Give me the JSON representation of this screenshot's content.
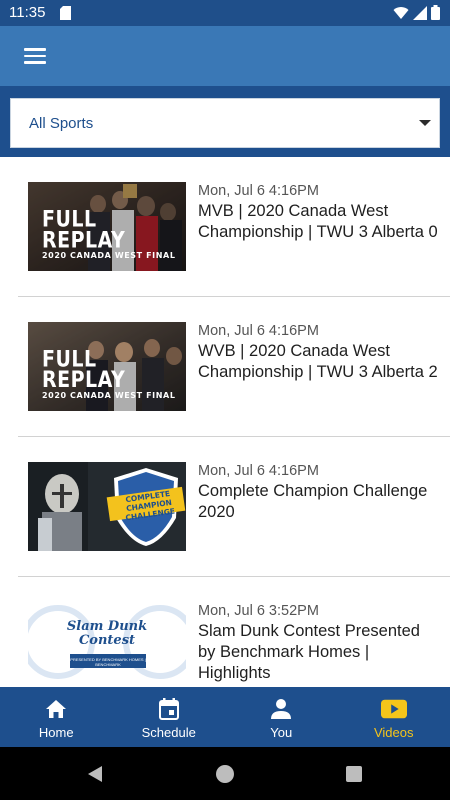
{
  "status_bar": {
    "time": "11:35"
  },
  "filter": {
    "selected": "All Sports"
  },
  "videos": [
    {
      "date": "Mon, Jul 6 4:16PM",
      "title": "MVB | 2020 Canada West Championship | TWU 3 Alberta 0",
      "thumb_line1": "FULL",
      "thumb_line2": "REPLAY",
      "thumb_sub": "2020 CANADA WEST FINAL"
    },
    {
      "date": "Mon, Jul 6 4:16PM",
      "title": "WVB | 2020 Canada West Championship | TWU 3 Alberta 2",
      "thumb_line1": "FULL",
      "thumb_line2": "REPLAY",
      "thumb_sub": "2020 CANADA WEST FINAL"
    },
    {
      "date": "Mon, Jul 6 4:16PM",
      "title": "Complete Champion Challenge 2020",
      "thumb_line1": "COMPLETE",
      "thumb_line2": "CHAMPION CHALLENGE"
    },
    {
      "date": "Mon, Jul 6 3:52PM",
      "title": "Slam Dunk Contest Presented by Benchmark Homes | Highlights",
      "thumb_line1": "Slam Dunk",
      "thumb_line2": "Contest",
      "thumb_sub": "PRESENTED BY BENCHMARK HOMES | BENCHMARK"
    }
  ],
  "nav": [
    {
      "label": "Home",
      "icon": "home-icon"
    },
    {
      "label": "Schedule",
      "icon": "calendar-icon"
    },
    {
      "label": "You",
      "icon": "person-icon"
    },
    {
      "label": "Videos",
      "icon": "video-icon"
    }
  ],
  "colors": {
    "primary": "#1e4f8d",
    "app_bar": "#3a78b6",
    "active_tab": "#f5c51a"
  }
}
